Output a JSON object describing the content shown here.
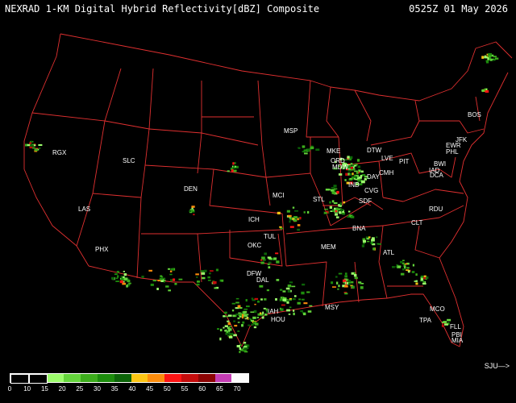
{
  "header": {
    "title": "NEXRAD 1-KM Digital Hybrid Reflectivity[dBZ] Composite",
    "datetime": "0525Z 01 May 2026"
  },
  "footer": {
    "sj_label": "SJU—>"
  },
  "legend": {
    "labels": [
      "0",
      "10",
      "15",
      "20",
      "25",
      "30",
      "35",
      "40",
      "45",
      "50",
      "55",
      "60",
      "65",
      "70"
    ],
    "colors": [
      "#000000",
      "#000000",
      "#9cfc6c",
      "#64d43c",
      "#3cac1c",
      "#1c8c0c",
      "#0c6408",
      "#fcc414",
      "#fc8c0c",
      "#fc1414",
      "#c40c0c",
      "#8c0404",
      "#c43cb4",
      "#fcfcfc"
    ]
  },
  "cities": [
    {
      "code": "RGX"
    },
    {
      "code": "SLC"
    },
    {
      "code": "DEN"
    },
    {
      "code": "LAS"
    },
    {
      "code": "PHX"
    },
    {
      "code": "MSP"
    },
    {
      "code": "MCI"
    },
    {
      "code": "ICH"
    },
    {
      "code": "TUL"
    },
    {
      "code": "OKC"
    },
    {
      "code": "DFW"
    },
    {
      "code": "DAL"
    },
    {
      "code": "IAH"
    },
    {
      "code": "HOU"
    },
    {
      "code": "MSY"
    },
    {
      "code": "MEM"
    },
    {
      "code": "STL"
    },
    {
      "code": "MKE"
    },
    {
      "code": "ORD"
    },
    {
      "code": "MDW"
    },
    {
      "code": "DTW"
    },
    {
      "code": "IND"
    },
    {
      "code": "DAY"
    },
    {
      "code": "CMH"
    },
    {
      "code": "CVG"
    },
    {
      "code": "SDF"
    },
    {
      "code": "BNA"
    },
    {
      "code": "ATL"
    },
    {
      "code": "CLT"
    },
    {
      "code": "RDU"
    },
    {
      "code": "PIT"
    },
    {
      "code": "LVE"
    },
    {
      "code": "PHL"
    },
    {
      "code": "EWR"
    },
    {
      "code": "JFK"
    },
    {
      "code": "BWI"
    },
    {
      "code": "IAD"
    },
    {
      "code": "DCA"
    },
    {
      "code": "BOS"
    },
    {
      "code": "MCO"
    },
    {
      "code": "TPA"
    },
    {
      "code": "FLL"
    },
    {
      "code": "MIA"
    },
    {
      "code": "PBI"
    }
  ]
}
